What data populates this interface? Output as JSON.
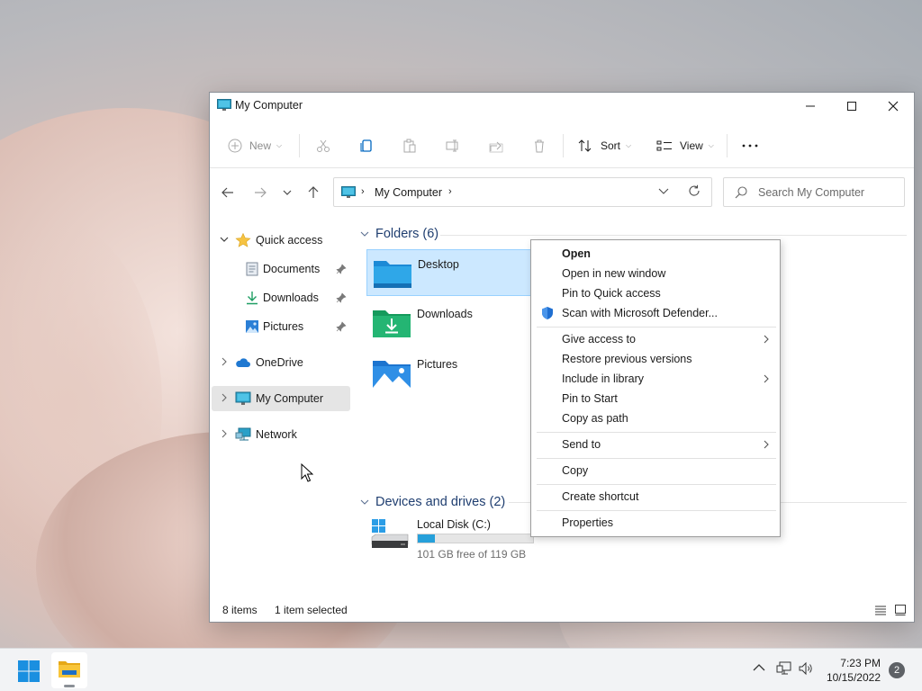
{
  "window": {
    "title": "My Computer"
  },
  "toolbar": {
    "new_label": "New",
    "sort_label": "Sort",
    "view_label": "View"
  },
  "address": {
    "location": "My Computer"
  },
  "search": {
    "placeholder": "Search My Computer"
  },
  "sidebar": {
    "quick_access": "Quick access",
    "items": [
      {
        "label": "Documents"
      },
      {
        "label": "Downloads"
      },
      {
        "label": "Pictures"
      }
    ],
    "onedrive": "OneDrive",
    "my_computer": "My Computer",
    "network": "Network"
  },
  "content": {
    "folders_header": "Folders (6)",
    "folders": [
      {
        "name": "Desktop"
      },
      {
        "name": "Downloads"
      },
      {
        "name": "Pictures"
      }
    ],
    "devices_header": "Devices and drives (2)",
    "drive": {
      "name": "Local Disk (C:)",
      "free_text": "101 GB free of 119 GB",
      "used_fraction": 0.15
    }
  },
  "status": {
    "item_count": "8 items",
    "selected": "1 item selected"
  },
  "context_menu": {
    "items": [
      {
        "label": "Open"
      },
      {
        "label": "Open in new window"
      },
      {
        "label": "Pin to Quick access"
      },
      {
        "label": "Scan with Microsoft Defender..."
      },
      {
        "label": "Give access to"
      },
      {
        "label": "Restore previous versions"
      },
      {
        "label": "Include in library"
      },
      {
        "label": "Pin to Start"
      },
      {
        "label": "Copy as path"
      },
      {
        "label": "Send to"
      },
      {
        "label": "Copy"
      },
      {
        "label": "Create shortcut"
      },
      {
        "label": "Properties"
      }
    ]
  },
  "taskbar": {
    "time": "7:23 PM",
    "date": "10/15/2022",
    "notification_count": "2"
  },
  "colors": {
    "accent": "#0078d4",
    "selection": "#cce8ff",
    "drive_fill": "#26a0da"
  }
}
